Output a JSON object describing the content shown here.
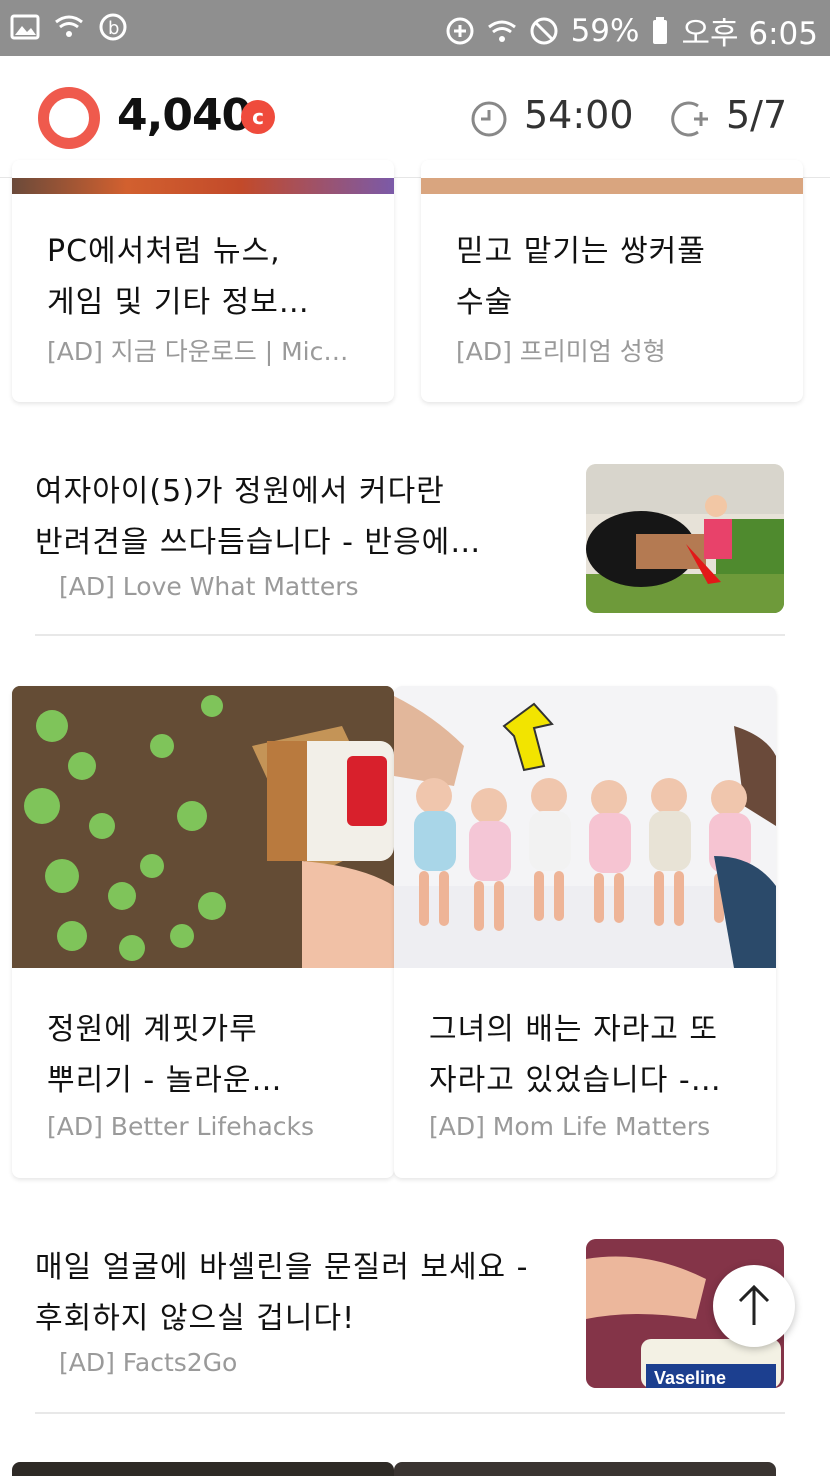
{
  "status_bar": {
    "battery": "59%",
    "time": "오후 6:05",
    "icons": [
      "image-icon",
      "wifi-star-icon",
      "b-app-icon",
      "data-saver-icon",
      "wifi-icon",
      "do-not-disturb-icon",
      "battery-icon"
    ]
  },
  "header": {
    "points": "4,040",
    "coin_badge": "c",
    "timer": "54:00",
    "progress": "5/7",
    "accent_color": "#ef5a4d"
  },
  "feed": {
    "top_cards": [
      {
        "title_line1": "PC에서처럼 뉴스,",
        "title_line2": "게임 및 기타 정보…",
        "source": "[AD] 지금 다운로드 | Mic…"
      },
      {
        "title_line1": "믿고 맡기는 쌍커풀",
        "title_line2": "수술",
        "source": "[AD] 프리미엄 성형"
      }
    ],
    "list_item_1": {
      "title_line1": "여자아이(5)가 정원에서 커다란",
      "title_line2": "반려견을 쓰다듬습니다 - 반응에…",
      "source": "[AD] Love What Matters"
    },
    "mid_cards": [
      {
        "title_line1": "정원에 계핏가루",
        "title_line2": "뿌리기 - 놀라운…",
        "source": "[AD] Better Lifehacks"
      },
      {
        "title_line1": "그녀의 배는 자라고 또",
        "title_line2": "자라고 있었습니다 -…",
        "source": "[AD] Mom Life Matters"
      }
    ],
    "list_item_2": {
      "title_line1": "매일 얼굴에 바셀린을 문질러 보세요 -",
      "title_line2": "후회하지 않으실 겁니다!",
      "source": "[AD] Facts2Go",
      "thumb_label": "Vaseline"
    }
  }
}
